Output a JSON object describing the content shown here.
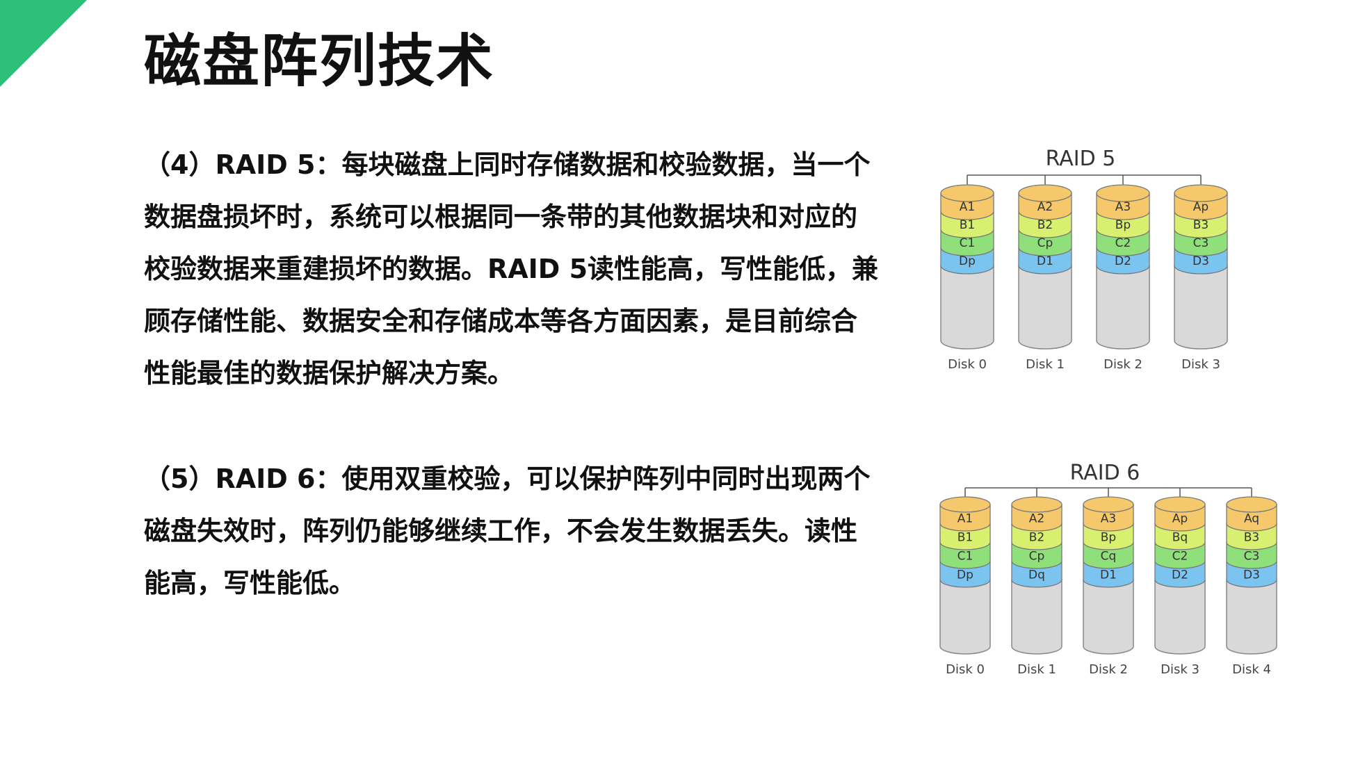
{
  "slide": {
    "title": "磁盘阵列技术",
    "colors": {
      "accent_corner": "#2ebf7a"
    }
  },
  "paragraphs": [
    "（4）RAID 5：每块磁盘上同时存储数据和校验数据，当一个数据盘损坏时，系统可以根据同一条带的其他数据块和对应的校验数据来重建损坏的数据。RAID 5读性能高，写性能低，兼顾存储性能、数据安全和存储成本等各方面因素，是目前综合性能最佳的数据保护解决方案。",
    "（5）RAID 6：使用双重校验，可以保护阵列中同时出现两个磁盘失效时，阵列仍能够继续工作，不会发生数据丢失。读性能高，写性能低。"
  ],
  "diagrams": {
    "raid5": {
      "title": "RAID 5",
      "disks": [
        {
          "label": "Disk 0",
          "blocks": [
            "A1",
            "B1",
            "C1",
            "Dp"
          ]
        },
        {
          "label": "Disk 1",
          "blocks": [
            "A2",
            "B2",
            "Cp",
            "D1"
          ]
        },
        {
          "label": "Disk 2",
          "blocks": [
            "A3",
            "Bp",
            "C2",
            "D2"
          ]
        },
        {
          "label": "Disk 3",
          "blocks": [
            "Ap",
            "B3",
            "C3",
            "D3"
          ]
        }
      ]
    },
    "raid6": {
      "title": "RAID 6",
      "disks": [
        {
          "label": "Disk 0",
          "blocks": [
            "A1",
            "B1",
            "C1",
            "Dp"
          ]
        },
        {
          "label": "Disk 1",
          "blocks": [
            "A2",
            "B2",
            "Cp",
            "Dq"
          ]
        },
        {
          "label": "Disk 2",
          "blocks": [
            "A3",
            "Bp",
            "Cq",
            "D1"
          ]
        },
        {
          "label": "Disk 3",
          "blocks": [
            "Ap",
            "Bq",
            "C2",
            "D2"
          ]
        },
        {
          "label": "Disk 4",
          "blocks": [
            "Aq",
            "B3",
            "C3",
            "D3"
          ]
        }
      ]
    },
    "stripe_colors": [
      "#f5c96b",
      "#d9ef6f",
      "#8fe07a",
      "#7cc4f0"
    ],
    "body_color": "#d9d9d9"
  }
}
